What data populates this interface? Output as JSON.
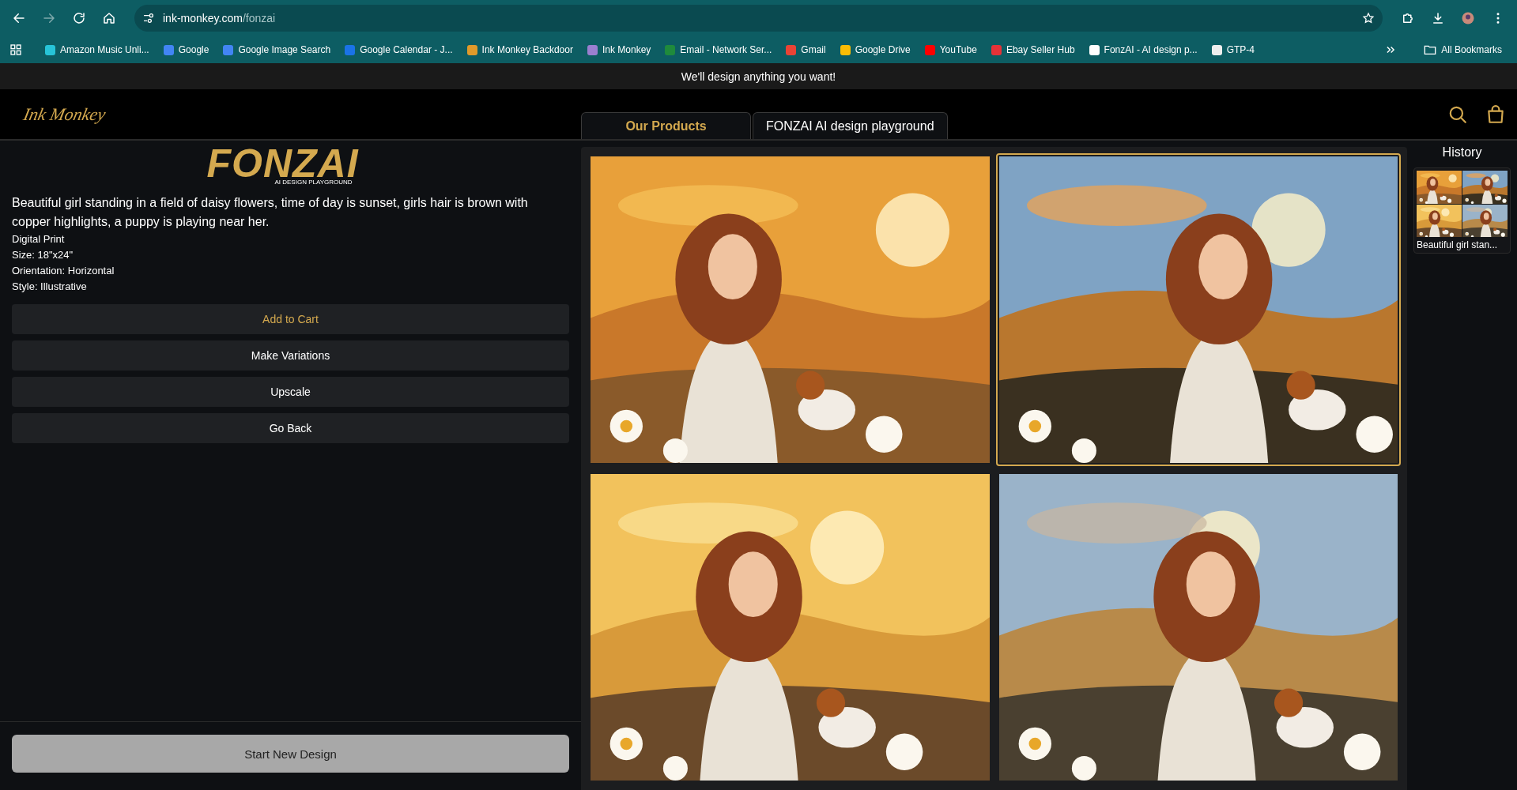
{
  "browser": {
    "url_host": "ink-monkey.com",
    "url_path": "/fonzai",
    "bookmarks": [
      {
        "label": "Amazon Music Unli...",
        "color": "#27c4d8"
      },
      {
        "label": "Google",
        "color": "#4285f4"
      },
      {
        "label": "Google Image Search",
        "color": "#4285f4"
      },
      {
        "label": "Google Calendar - J...",
        "color": "#1a73e8"
      },
      {
        "label": "Ink Monkey Backdoor",
        "color": "#e09a2a"
      },
      {
        "label": "Ink Monkey",
        "color": "#9a7fd0"
      },
      {
        "label": "Email - Network Ser...",
        "color": "#1f8a3c"
      },
      {
        "label": "Gmail",
        "color": "#ea4335"
      },
      {
        "label": "Google Drive",
        "color": "#fbbc04"
      },
      {
        "label": "YouTube",
        "color": "#ff0000"
      },
      {
        "label": "Ebay Seller Hub",
        "color": "#e53238"
      },
      {
        "label": "FonzAI - AI design p...",
        "color": "#ffffff"
      },
      {
        "label": "GTP-4",
        "color": "#eeeeee"
      }
    ],
    "all_bookmarks": "All Bookmarks"
  },
  "announcement": "We'll design anything you want!",
  "site": {
    "logo": "Ink Monkey",
    "tabs": [
      {
        "label": "Our Products",
        "selected": true
      },
      {
        "label": "FONZAI AI design playground",
        "selected": false
      }
    ]
  },
  "brand": {
    "name": "FONZAI",
    "tagline": "AI DESIGN PLAYGROUND"
  },
  "prompt": "Beautiful girl standing in a field of daisy flowers, time of day is sunset, girls hair is brown with copper highlights, a puppy is playing near her.",
  "details": [
    "Digital Print",
    "Size: 18\"x24\"",
    "Orientation: Horizontal",
    "Style: Illustrative"
  ],
  "actions": [
    {
      "label": "Add to Cart",
      "kind": "accent"
    },
    {
      "label": "Make Variations",
      "kind": "plain"
    },
    {
      "label": "Upscale",
      "kind": "plain"
    },
    {
      "label": "Go Back",
      "kind": "plain"
    }
  ],
  "start_button": "Start New Design",
  "gallery": [
    {
      "kind": "picture",
      "selected": false
    },
    {
      "kind": "picture",
      "selected": true
    },
    {
      "kind": "picture",
      "selected": false
    },
    {
      "kind": "picture",
      "selected": false
    }
  ],
  "history": {
    "title": "History",
    "items": [
      {
        "caption": "Beautiful girl stan..."
      }
    ]
  }
}
